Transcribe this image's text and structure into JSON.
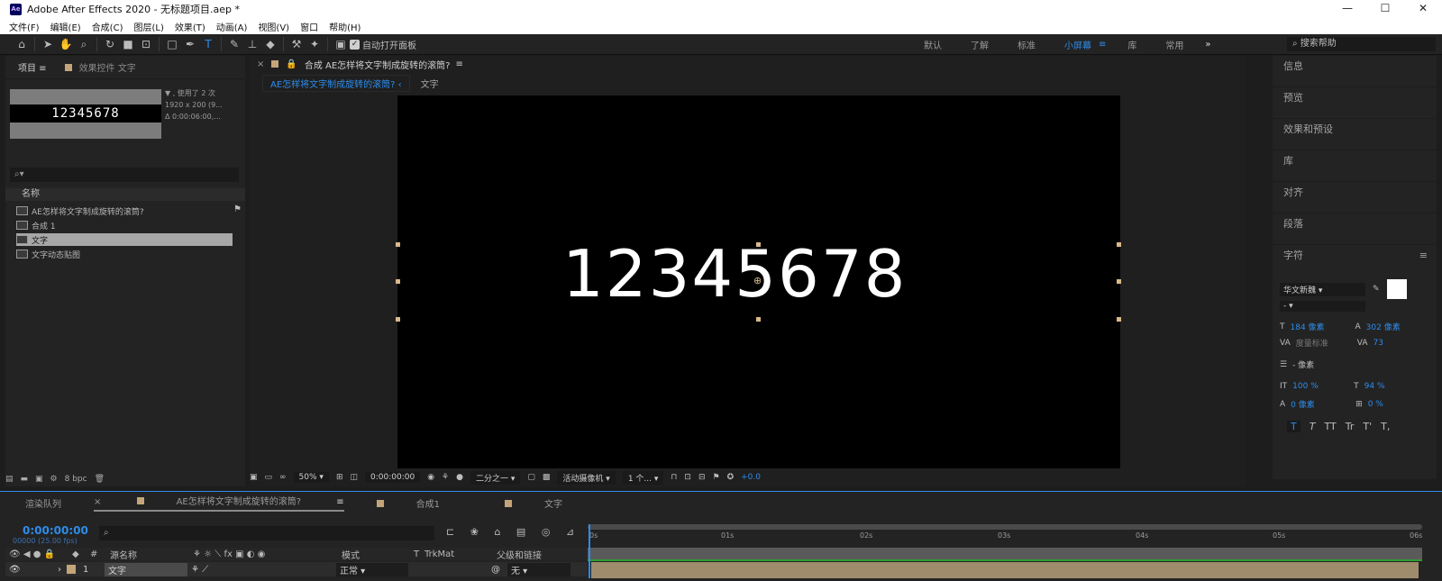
{
  "window": {
    "title": "Adobe After Effects 2020 - 无标题项目.aep *",
    "logo": "Ae",
    "controls": [
      "—",
      "☐",
      "✕"
    ]
  },
  "menu": [
    "文件(F)",
    "编辑(E)",
    "合成(C)",
    "图层(L)",
    "效果(T)",
    "动画(A)",
    "视图(V)",
    "窗口",
    "帮助(H)"
  ],
  "toolbar": {
    "auto_open_label": "自动打开面板",
    "workspaces": [
      "默认",
      "了解",
      "标准",
      "小屏幕",
      "库",
      "常用"
    ],
    "active_workspace": "小屏幕",
    "search_placeholder": "搜索帮助"
  },
  "project_panel": {
    "tabs": [
      "项目",
      "效果控件 文字"
    ],
    "thumbnail_text": "12345678",
    "thumb_info": [
      "▼ , 使用了 2 次",
      "1920 x 200 (9...",
      "Δ 0:00:06:00,..."
    ],
    "column_name": "名称",
    "items": [
      "AE怎样将文字制成旋转的滚筒?",
      "合成 1",
      "文字",
      "文字动态贴图"
    ],
    "selected_index": 2,
    "bpc": "8 bpc"
  },
  "viewer": {
    "comp_tab": "合成 AE怎样将文字制成旋转的滚筒?",
    "breadcrumb_active": "AE怎样将文字制成旋转的滚筒?",
    "breadcrumb_next": "文字",
    "canvas_text": "12345678",
    "zoom": "50%",
    "timecode": "0:00:00:00",
    "resolution": "二分之一",
    "camera": "活动摄像机",
    "views": "1 个...",
    "exposure": "+0.0"
  },
  "right_panel": {
    "items": [
      "信息",
      "预览",
      "效果和预设",
      "库",
      "对齐",
      "段落"
    ],
    "character": {
      "title": "字符",
      "font": "华文新魏",
      "style": "-",
      "font_size": "184 像素",
      "leading": "302 像素",
      "kerning": "度量标准",
      "tracking": "73",
      "stroke": "- 像素",
      "vscale": "100 %",
      "hscale": "94 %",
      "baseline": "0 像素",
      "tsume": "0 %",
      "styles": [
        "T",
        "T",
        "TT",
        "Tr",
        "T'",
        "T,"
      ]
    }
  },
  "timeline": {
    "tabs": [
      "渲染队列",
      "AE怎样将文字制成旋转的滚筒?",
      "合成1",
      "文字"
    ],
    "active_tab": "AE怎样将文字制成旋转的滚筒?",
    "timecode": "0:00:00:00",
    "fps": "00000 (25.00 fps)",
    "columns": [
      "源名称",
      "模式",
      "T",
      "TrkMat",
      "父级和链接"
    ],
    "layer": {
      "index": "1",
      "name": "文字",
      "mode": "正常",
      "parent": "无"
    },
    "ruler": [
      "0s",
      "01s",
      "02s",
      "03s",
      "04s",
      "05s",
      "06s"
    ]
  },
  "colors": {
    "accent": "#2d8ceb",
    "panel": "#232323",
    "layer_tan": "#9f8c6d",
    "workarea_green": "#2f9d34"
  }
}
